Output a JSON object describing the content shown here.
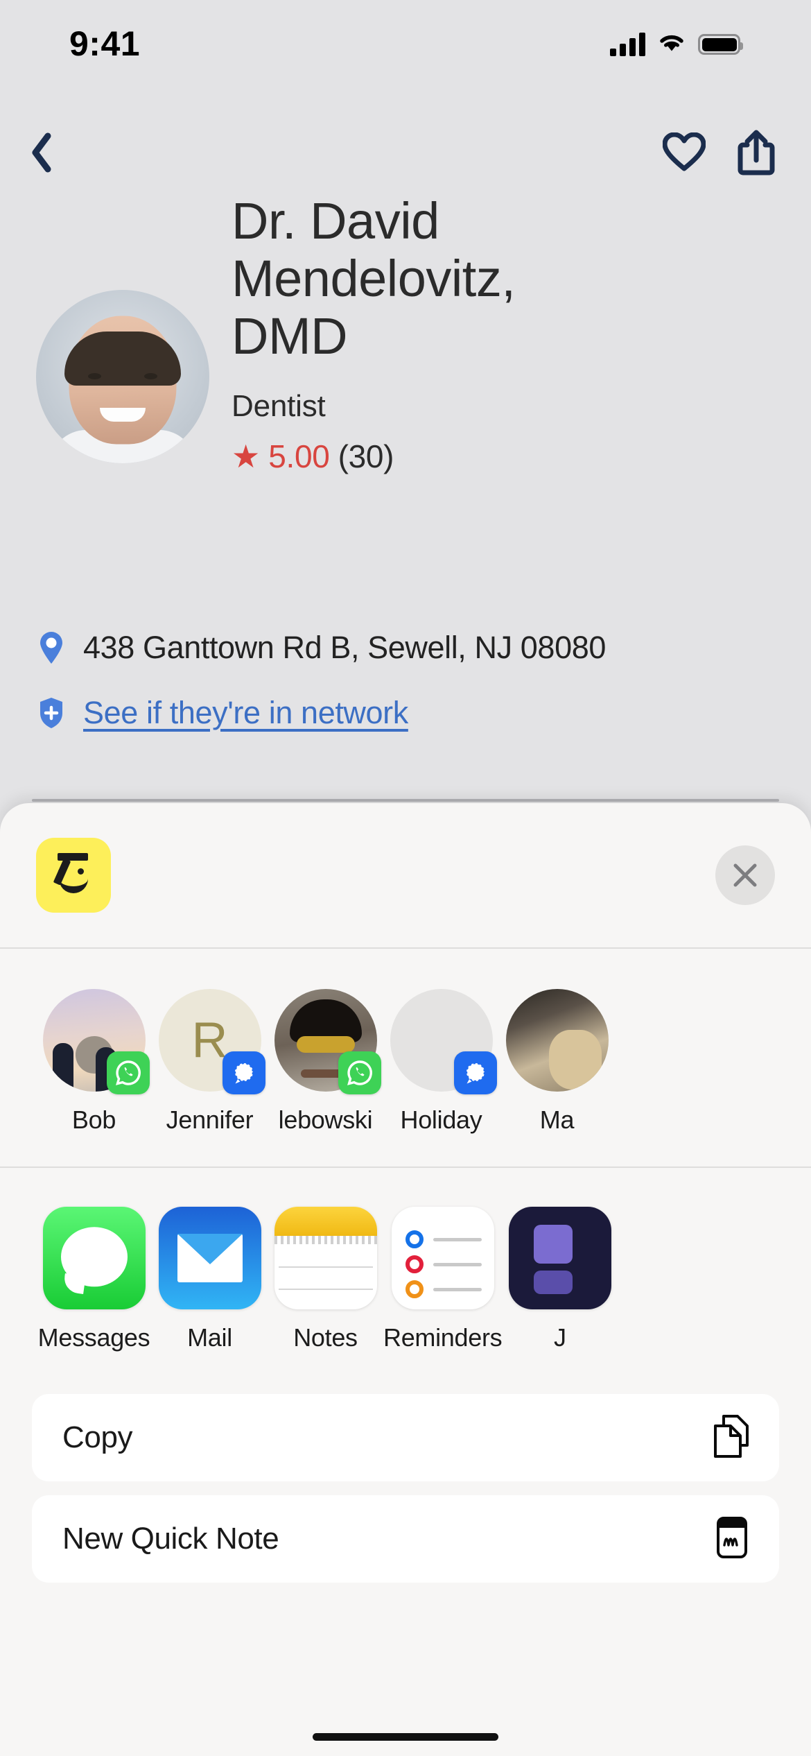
{
  "status_bar": {
    "time": "9:41",
    "signal_icon": "cellular-signal-icon",
    "wifi_icon": "wifi-icon",
    "battery_icon": "battery-full-icon"
  },
  "nav_bar": {
    "back_icon": "back-chevron-icon",
    "favorite_icon": "heart-outline-icon",
    "share_icon": "share-up-arrow-icon"
  },
  "profile": {
    "name": "Dr. David Mendelovitz, DMD",
    "specialty": "Dentist",
    "rating_star": "★",
    "rating_value": "5.00",
    "rating_count": "(30)",
    "rating_color": "#d8453f",
    "avatar_name": "doctor-headshot-avatar"
  },
  "info": {
    "address": "438 Ganttown Rd B, Sewell, NJ 08080",
    "address_icon": "map-pin-icon",
    "network_link": "See if they're in network",
    "network_icon": "shield-plus-icon",
    "link_color": "#3c6fc4"
  },
  "share_sheet": {
    "app_badge_name": "zocdoc-app-icon",
    "app_badge_color": "#fdef5a",
    "close_label": "✕",
    "contacts": [
      {
        "name": "Bob",
        "avatar": "photo-two-people-sunset",
        "service": "whatsapp",
        "service_icon": "whatsapp-icon"
      },
      {
        "name": "Jennifer",
        "avatar": "initial-avatar",
        "initial": "R",
        "service": "signal",
        "service_icon": "signal-icon"
      },
      {
        "name": "lebowski",
        "avatar": "photo-man-sunglasses",
        "service": "whatsapp",
        "service_icon": "whatsapp-icon"
      },
      {
        "name": "Holiday",
        "avatar": "blank-gray-avatar",
        "service": "signal",
        "service_icon": "signal-icon"
      },
      {
        "name": "Ma",
        "avatar": "photo-cat",
        "service": "none",
        "service_icon": ""
      }
    ],
    "apps": [
      {
        "name": "Messages",
        "icon": "messages-app-icon"
      },
      {
        "name": "Mail",
        "icon": "mail-app-icon"
      },
      {
        "name": "Notes",
        "icon": "notes-app-icon"
      },
      {
        "name": "Reminders",
        "icon": "reminders-app-icon"
      },
      {
        "name": "J",
        "icon": "jira-app-icon"
      }
    ],
    "actions": [
      {
        "label": "Copy",
        "icon": "copy-documents-icon"
      },
      {
        "label": "New Quick Note",
        "icon": "quick-note-icon"
      }
    ]
  }
}
